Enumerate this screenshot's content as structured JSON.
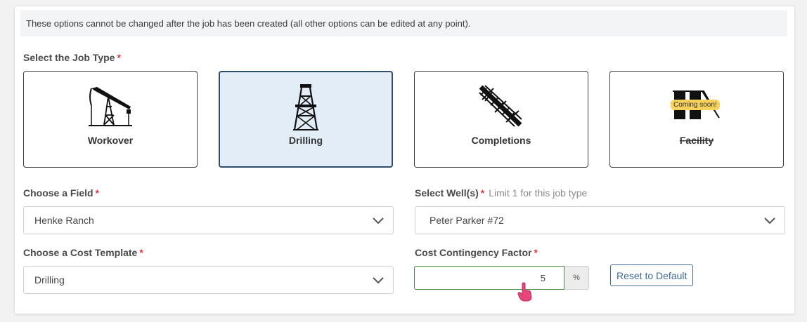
{
  "notice": "These options cannot be changed after the job has been created (all other options can be edited at any point).",
  "job_type": {
    "label": "Select the Job Type",
    "required_mark": "*",
    "selected": "Drilling",
    "options": [
      {
        "name": "Workover",
        "icon": "pumpjack-icon"
      },
      {
        "name": "Drilling",
        "icon": "drilling-rig-icon"
      },
      {
        "name": "Completions",
        "icon": "frac-line-icon"
      },
      {
        "name": "Facility",
        "icon": "facility-icon",
        "badge": "Coming soon!"
      }
    ]
  },
  "field": {
    "label": "Choose a Field",
    "required_mark": "*",
    "value": "Henke Ranch"
  },
  "wells": {
    "label": "Select Well(s)",
    "required_mark": "*",
    "hint": "Limit 1 for this job type",
    "value": "Peter Parker #72"
  },
  "cost_template": {
    "label": "Choose a Cost Template",
    "required_mark": "*",
    "value": "Drilling"
  },
  "contingency": {
    "label": "Cost Contingency Factor",
    "required_mark": "*",
    "value": "5",
    "unit": "%",
    "reset_label": "Reset to Default"
  },
  "colors": {
    "required": "#e0383e",
    "selected_card_bg": "#e2edf8",
    "selected_card_border": "#2e4c6d",
    "badge": "#f6d25d",
    "reset_button": "#3f6a96",
    "input_focus_border": "#4a8a4a"
  }
}
